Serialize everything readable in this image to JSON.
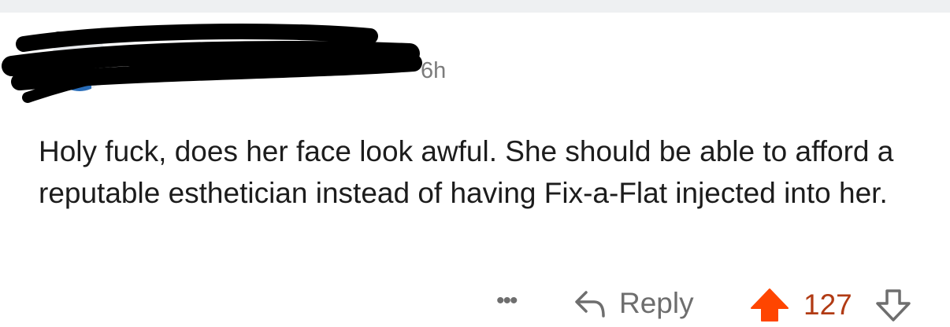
{
  "comment": {
    "time_ago": "6h",
    "body": "Holy fuck, does her face look awful. She should be able to afford a reputable esthetician instead of having Fix-a-Flat injected into her.",
    "author": ""
  },
  "actions": {
    "more_label": "•••",
    "reply_label": "Reply",
    "vote_count": "127",
    "upvote_active": true
  },
  "colors": {
    "upvote": "#ff4500",
    "vote_count": "#b13b14",
    "muted": "#6e6e6e",
    "body_text": "#1c1c1c",
    "top_strip": "#eef0f2"
  },
  "icons": {
    "more": "ellipsis-icon",
    "reply": "reply-arrow-icon",
    "upvote": "arrow-up-icon",
    "downvote": "arrow-down-icon"
  }
}
